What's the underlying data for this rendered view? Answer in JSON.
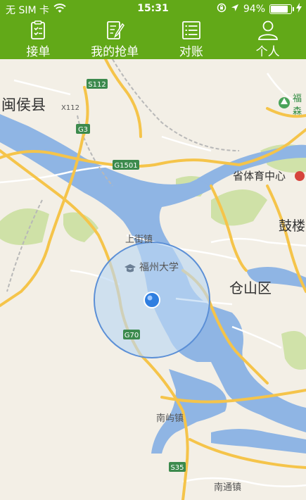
{
  "status_bar": {
    "carrier": "无 SIM 卡",
    "time": "15:31",
    "battery_percent": "94%",
    "battery_level": 0.94
  },
  "tabs": [
    {
      "label": "接单",
      "icon": "clipboard-check-icon"
    },
    {
      "label": "我的抢单",
      "icon": "document-edit-icon"
    },
    {
      "label": "对账",
      "icon": "list-icon"
    },
    {
      "label": "个人",
      "icon": "person-icon"
    }
  ],
  "map": {
    "place_labels": {
      "minhou": "闽侯县",
      "fu_label": "福",
      "sen_label": "森",
      "stadium": "省体育中心",
      "gu": "鼓楼",
      "shangjie": "上街镇",
      "fuzhou_univ": "福州大学",
      "cangshan": "仓山区",
      "nanyu": "南屿镇",
      "nantong": "南通镇"
    },
    "road_shields": {
      "s112": "S112",
      "x112": "X112",
      "g3": "G3",
      "g1501": "G1501",
      "g70": "G70",
      "s35": "S35"
    },
    "colors": {
      "water": "#8fb5e4",
      "land": "#f3efe6",
      "park": "#c9df9d",
      "highway": "#f5c44a",
      "road": "#ffffff",
      "location_dot": "#2f7ee0",
      "accuracy_fill": "#bcd7f3",
      "accuracy_stroke": "#5b8fd6"
    }
  }
}
